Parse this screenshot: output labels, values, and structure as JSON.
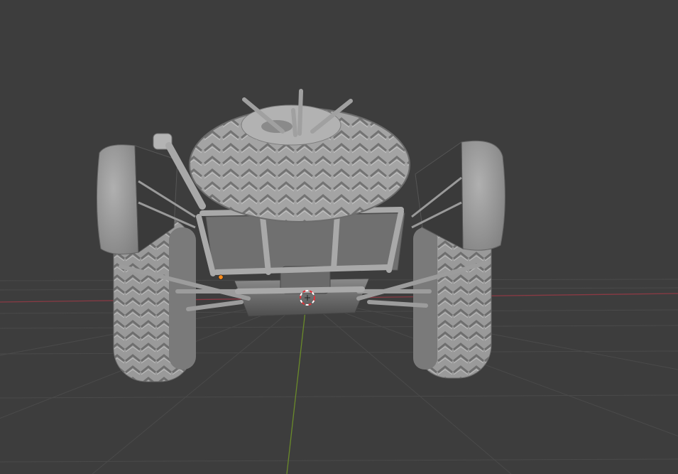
{
  "viewport": {
    "mode": "solid",
    "colors": {
      "background": "#3d3d3d",
      "grid_line": "#4a4a4a",
      "x_axis": "#8a3a44",
      "y_axis": "#6a8a2a",
      "model_light": "#a8a8a8",
      "model_mid": "#8e8e8e",
      "model_dark": "#5a5a5a",
      "origin_dot": "#ff8c1a",
      "cursor_red": "#e0333a",
      "cursor_white": "#ffffff"
    },
    "icons": {
      "cursor": "3d-cursor-icon",
      "origin": "object-origin-icon"
    }
  }
}
